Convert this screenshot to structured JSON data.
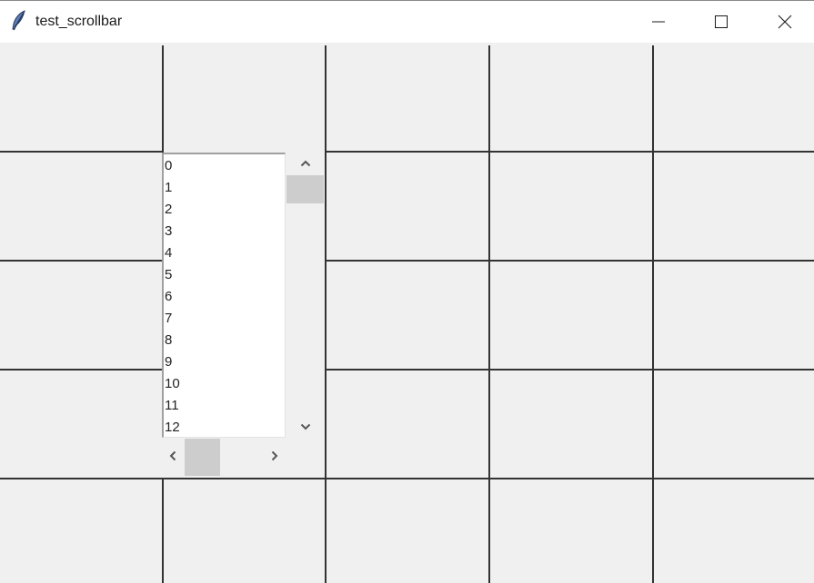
{
  "window": {
    "title": "test_scrollbar",
    "icon": "feather-icon",
    "controls": {
      "minimize_icon": "minimize-icon",
      "maximize_icon": "maximize-icon",
      "close_icon": "close-icon"
    }
  },
  "listbox": {
    "items": [
      "0",
      "1",
      "2",
      "3",
      "4",
      "5",
      "6",
      "7",
      "8",
      "9",
      "10",
      "11",
      "12"
    ]
  },
  "vertical_scrollbar": {
    "up_icon": "chevron-up-icon",
    "down_icon": "chevron-down-icon"
  },
  "horizontal_scrollbar": {
    "left_icon": "chevron-left-icon",
    "right_icon": "chevron-right-icon"
  },
  "colors": {
    "titlebar": "#ffffff",
    "background": "#f0f0f0",
    "grid_line": "#333333",
    "scroll_thumb": "#cdcdcd",
    "listbox_bg": "#ffffff"
  }
}
